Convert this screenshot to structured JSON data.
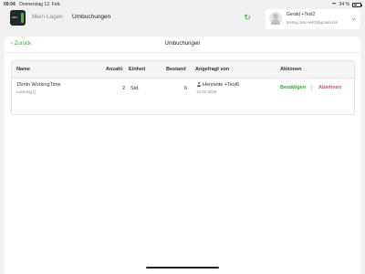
{
  "status_bar": {
    "time": "09:04",
    "date": "Donnerstag 12. Feb.",
    "battery": "34 %",
    "battery_level": 0.34
  },
  "header": {
    "logo_text": "ANY",
    "breadcrumb": [
      "Mein Lager",
      "Umbuchungen"
    ],
    "refresh_icon": "refresh-icon",
    "user": {
      "name": "Gerald +Test2",
      "email": "testing.pwa+test2@gmail.com"
    }
  },
  "page": {
    "back_label": "Zurück",
    "title": "Umbuchungen",
    "table": {
      "columns": [
        "Name",
        "Anzahl",
        "Einheit",
        "Bestand",
        "Angefragt von",
        "Aktionen"
      ],
      "rows": [
        {
          "name": "15min WorkingTime",
          "subtitle": "Leistung ()",
          "count": "2",
          "unit": "Std.",
          "stock": "6",
          "requested_by": "Henriette +Test6",
          "requested_date": "12.02.2026",
          "approve_label": "Bestätigen",
          "reject_label": "Ablehnen"
        }
      ]
    }
  },
  "colors": {
    "accent": "#3aa33a",
    "danger": "#e24b4b",
    "background": "#f1f1f2"
  }
}
